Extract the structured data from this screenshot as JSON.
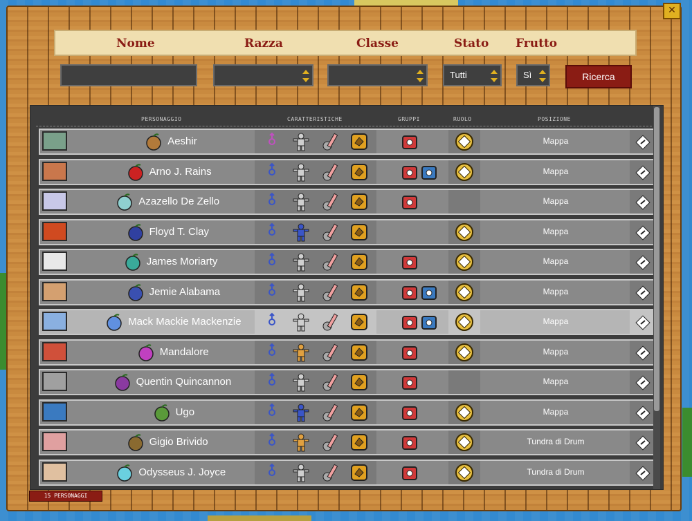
{
  "window": {
    "close_label": "✕"
  },
  "filters": {
    "headers": [
      "Nome",
      "Razza",
      "Classe",
      "Stato",
      "Frutto"
    ],
    "stato_value": "Tutti",
    "frutto_value": "Sì",
    "search_label": "Ricerca"
  },
  "table": {
    "columns": [
      "PERSONAGGIO",
      "CARATTERISTICHE",
      "GRUPPI",
      "RUOLO",
      "POSIZIONE"
    ],
    "rows": [
      {
        "name": "Aeshir",
        "sex": "female",
        "position": "Mappa",
        "fruit_color": "#b27a3a",
        "avatar_color": "#7aa08a",
        "race_color": "#cfcfcf",
        "groups": 1,
        "role": true
      },
      {
        "name": "Arno J. Rains",
        "sex": "male",
        "position": "Mappa",
        "fruit_color": "#cc2222",
        "avatar_color": "#c9774c",
        "race_color": "#cfcfcf",
        "groups": 2,
        "role": true
      },
      {
        "name": "Azazello De Zello",
        "sex": "male",
        "position": "Mappa",
        "fruit_color": "#8fd0d0",
        "avatar_color": "#c8c8e8",
        "race_color": "#cfcfcf",
        "groups": 1,
        "role": false
      },
      {
        "name": "Floyd T. Clay",
        "sex": "male",
        "position": "Mappa",
        "fruit_color": "#3040a0",
        "avatar_color": "#d04a20",
        "race_color": "#3a55c8",
        "groups": 0,
        "role": true
      },
      {
        "name": "James Moriarty",
        "sex": "male",
        "position": "Mappa",
        "fruit_color": "#3aaa9a",
        "avatar_color": "#e8e8e8",
        "race_color": "#cfcfcf",
        "groups": 1,
        "role": true
      },
      {
        "name": "Jemie Alabama",
        "sex": "male",
        "position": "Mappa",
        "fruit_color": "#3a50b0",
        "avatar_color": "#d4a070",
        "race_color": "#cfcfcf",
        "groups": 2,
        "role": true
      },
      {
        "name": "Mack Mackie Mackenzie",
        "sex": "male",
        "position": "Mappa",
        "fruit_color": "#6090e0",
        "avatar_color": "#8ab0e0",
        "race_color": "#cfcfcf",
        "groups": 2,
        "role": true
      },
      {
        "name": "Mandalore",
        "sex": "male",
        "position": "Mappa",
        "fruit_color": "#c040c0",
        "avatar_color": "#d0503a",
        "race_color": "#e0a040",
        "groups": 1,
        "role": true
      },
      {
        "name": "Quentin Quincannon",
        "sex": "male",
        "position": "Mappa",
        "fruit_color": "#8a3aa0",
        "avatar_color": "#a0a0a0",
        "race_color": "#cfcfcf",
        "groups": 1,
        "role": false
      },
      {
        "name": "Ugo",
        "sex": "male",
        "position": "Mappa",
        "fruit_color": "#5a9a3a",
        "avatar_color": "#3a7ac0",
        "race_color": "#3a55c8",
        "groups": 1,
        "role": true
      },
      {
        "name": "Gigio Brivido",
        "sex": "male",
        "position": "Tundra di Drum",
        "fruit_color": "#8a6a30",
        "avatar_color": "#e0a0a0",
        "race_color": "#e0a040",
        "groups": 1,
        "role": true
      },
      {
        "name": "Odysseus J. Joyce",
        "sex": "male",
        "position": "Tundra di Drum",
        "fruit_color": "#6ad0e0",
        "avatar_color": "#e0c0a0",
        "race_color": "#cfcfcf",
        "groups": 1,
        "role": true
      }
    ]
  },
  "footer": {
    "count_label": "15 PERSONAGGI"
  }
}
